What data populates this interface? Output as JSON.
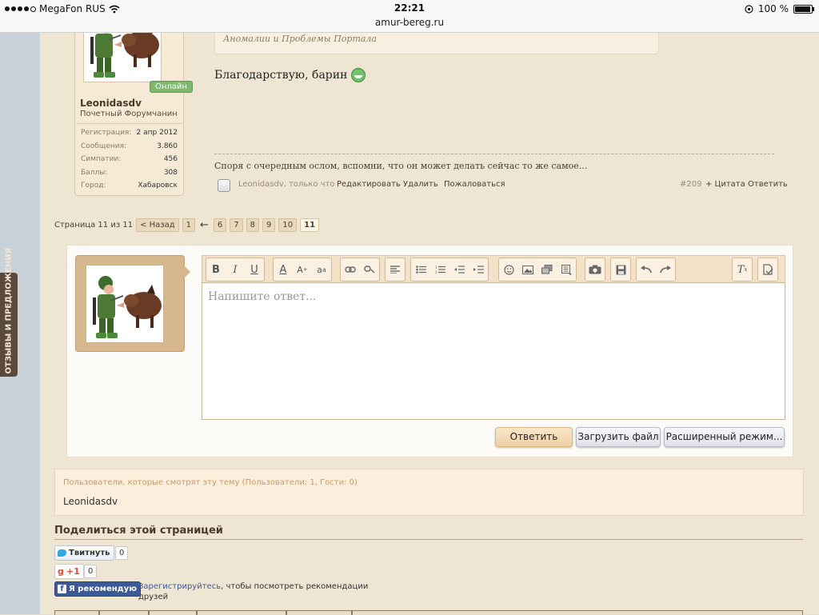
{
  "statusbar": {
    "carrier": "MegaFon RUS",
    "time": "22:21",
    "url": "amur-bereg.ru",
    "battery": "100 %",
    "signal_bars": 4
  },
  "feedback_tab": {
    "label": "ОТЗЫВЫ И ПРЕДЛОЖЕНИЯ"
  },
  "user_card": {
    "status": "Онлайн",
    "username": "Leonidasdv",
    "title": "Почетный Форумчанин",
    "stats": [
      {
        "label": "Регистрация:",
        "value": "2 апр 2012"
      },
      {
        "label": "Сообщения:",
        "value": "3.860"
      },
      {
        "label": "Симпатии:",
        "value": "456"
      },
      {
        "label": "Баллы:",
        "value": "308"
      },
      {
        "label": "Город:",
        "value": "Хабаровск"
      }
    ]
  },
  "post": {
    "quote_text": "Аномалии и Проблемы Портала",
    "text": "Благодарствую, барин",
    "signature": "Споря с очередным ослом, вспомни, что он может делать сейчас то же самое...",
    "footer": {
      "meta": "Leonidasdv, только что",
      "edit": "Редактировать",
      "delete": "Удалить",
      "report": "Пожаловаться",
      "number": "#209",
      "quote": "+ Цитата",
      "reply": "Ответить"
    }
  },
  "pagination": {
    "label": "Страница 11 из 11",
    "prev": "< Назад",
    "first": "1",
    "arrow": "←",
    "pages": [
      "6",
      "7",
      "8",
      "9",
      "10",
      "11"
    ],
    "current": "11"
  },
  "reply": {
    "placeholder": "Напишите ответ...",
    "buttons": {
      "reply": "Ответить",
      "upload": "Загрузить файл",
      "advanced": "Расширенный режим..."
    }
  },
  "viewers": {
    "heading": "Пользователи, которые смотрят эту тему (Пользователи: 1, Гости: 0)",
    "users": "Leonidasdv"
  },
  "share": {
    "title": "Поделиться этой страницей",
    "tweet": {
      "label": "Твитнуть",
      "count": "0"
    },
    "gplus": {
      "label": "+1",
      "count": "0"
    },
    "facebook": {
      "label": "Я рекомендую",
      "link": "Зарегистрируйтесь",
      "text": ", чтобы посмотреть рекомендации друзей"
    }
  },
  "colors": {
    "page_bg": "#efe5d3",
    "card_bg": "#f4ead6",
    "online": "#7cb96a",
    "facebook": "#3b5998",
    "twitter": "#2fa9e0"
  }
}
